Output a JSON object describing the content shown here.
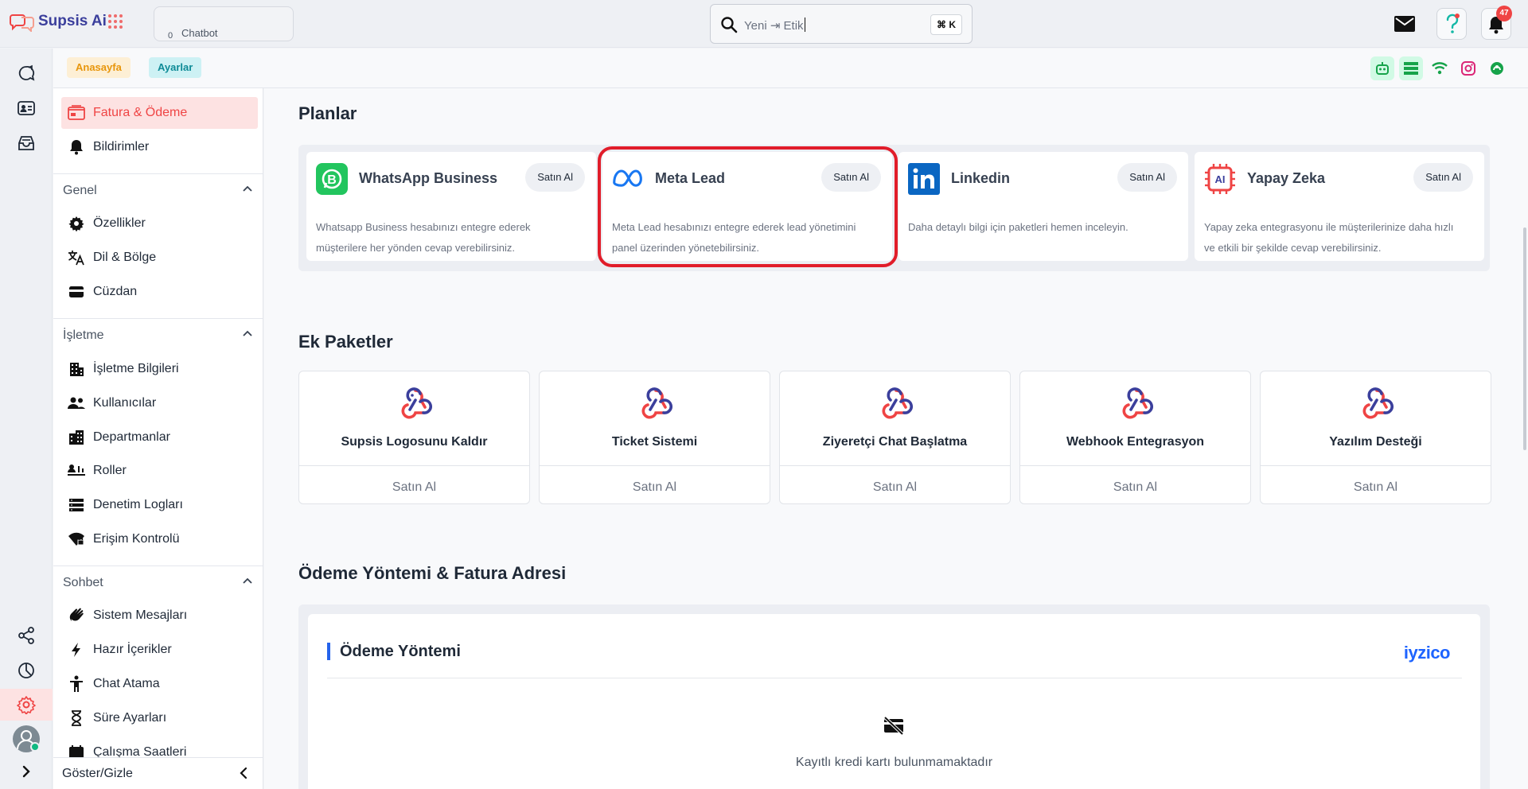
{
  "app": {
    "brand": "Supsis Ai"
  },
  "topbar": {
    "chatbot_tab": {
      "label": "Chatbot",
      "count": "0"
    },
    "search": {
      "text": "Yeni ⇥ Etik",
      "shortcut": "⌘ K"
    },
    "notifications_count": "47"
  },
  "breadcrumb": {
    "home": "Anasayfa",
    "current": "Ayarlar"
  },
  "sidebar": {
    "top_items": [
      {
        "label": "Fatura & Ödeme",
        "icon": "billing-icon",
        "active": true
      },
      {
        "label": "Bildirimler",
        "icon": "bell-icon"
      }
    ],
    "sections": [
      {
        "title": "Genel",
        "items": [
          {
            "label": "Özellikler",
            "icon": "gear-icon"
          },
          {
            "label": "Dil & Bölge",
            "icon": "translate-icon"
          },
          {
            "label": "Cüzdan",
            "icon": "wallet-icon"
          }
        ]
      },
      {
        "title": "İşletme",
        "items": [
          {
            "label": "İşletme Bilgileri",
            "icon": "building-icon"
          },
          {
            "label": "Kullanıcılar",
            "icon": "users-icon"
          },
          {
            "label": "Departmanlar",
            "icon": "department-icon"
          },
          {
            "label": "Roller",
            "icon": "roles-icon"
          },
          {
            "label": "Denetim Logları",
            "icon": "list-icon"
          },
          {
            "label": "Erişim Kontrolü",
            "icon": "access-icon"
          }
        ]
      },
      {
        "title": "Sohbet",
        "items": [
          {
            "label": "Sistem Mesajları",
            "icon": "wave-icon"
          },
          {
            "label": "Hazır İçerikler",
            "icon": "bolt-icon"
          },
          {
            "label": "Chat Atama",
            "icon": "person-icon"
          },
          {
            "label": "Süre Ayarları",
            "icon": "hourglass-icon"
          },
          {
            "label": "Çalışma Saatleri",
            "icon": "calendar-icon"
          }
        ]
      }
    ],
    "toggle_label": "Göster/Gizle"
  },
  "main": {
    "plans_title": "Planlar",
    "plans": [
      {
        "name": "WhatsApp Business",
        "buy": "Satın Al",
        "desc": "Whatsapp Business hesabınızı entegre ederek müşterilere her yönden cevap verebilirsiniz.",
        "icon": "whatsapp-icon"
      },
      {
        "name": "Meta Lead",
        "buy": "Satın Al",
        "desc": "Meta Lead hesabınızı entegre ederek lead yönetimini panel üzerinden yönetebilirsiniz.",
        "icon": "meta-icon"
      },
      {
        "name": "Linkedin",
        "buy": "Satın Al",
        "desc": "Daha detaylı bilgi için paketleri hemen inceleyin.",
        "icon": "linkedin-icon"
      },
      {
        "name": "Yapay Zeka",
        "buy": "Satın Al",
        "desc": "Yapay zeka entegrasyonu ile müşterilerinize daha hızlı ve etkili bir şekilde cevap verebilirsiniz.",
        "icon": "ai-chip-icon"
      }
    ],
    "extras_title": "Ek Paketler",
    "extras": [
      {
        "name": "Supsis Logosunu Kaldır",
        "buy": "Satın Al"
      },
      {
        "name": "Ticket Sistemi",
        "buy": "Satın Al"
      },
      {
        "name": "Ziyeretçi Chat Başlatma",
        "buy": "Satın Al"
      },
      {
        "name": "Webhook Entegrasyon",
        "buy": "Satın Al"
      },
      {
        "name": "Yazılım Desteği",
        "buy": "Satın Al"
      }
    ],
    "payment_title": "Ödeme Yöntemi & Fatura Adresi",
    "payment": {
      "card_title": "Ödeme Yöntemi",
      "provider": "iyzico",
      "empty": "Kayıtlı kredi kartı bulunmamaktadır"
    }
  },
  "colors": {
    "accent": "#ef4444",
    "brand": "#3b3f9c",
    "highlight": "#e11d2a",
    "link": "#2563eb"
  }
}
